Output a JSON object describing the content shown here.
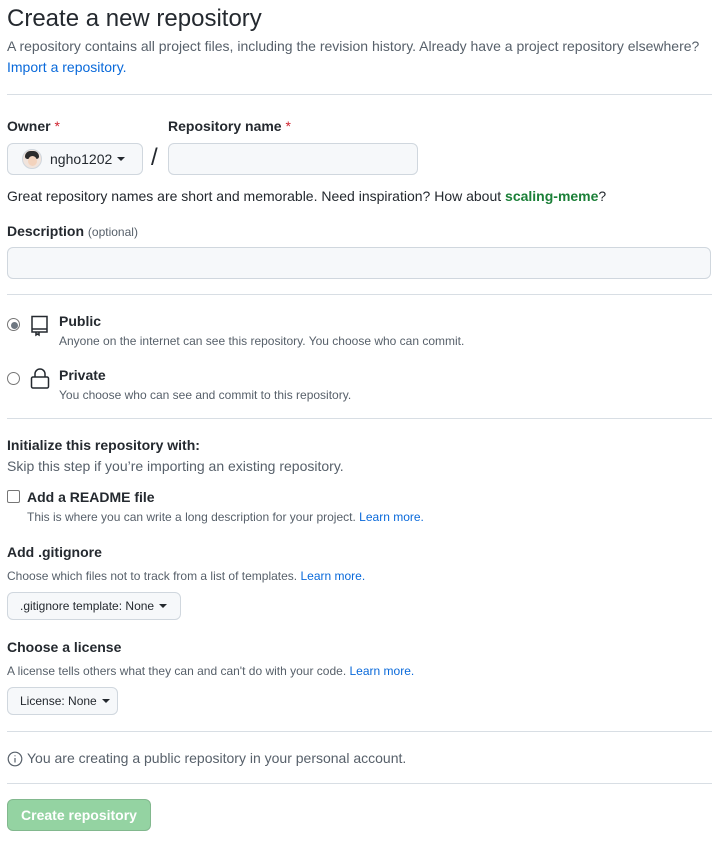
{
  "header": {
    "title": "Create a new repository",
    "subtitle": "A repository contains all project files, including the revision history. Already have a project repository elsewhere?",
    "import_link": "Import a repository."
  },
  "owner": {
    "label": "Owner",
    "required_mark": "*",
    "value": "ngho1202"
  },
  "repo_name": {
    "label": "Repository name",
    "required_mark": "*",
    "value": "",
    "slash": "/"
  },
  "suggestion": {
    "prefix": "Great repository names are short and memorable. Need inspiration? How about ",
    "name": "scaling-meme",
    "suffix": "?"
  },
  "description": {
    "label": "Description",
    "optional": "(optional)",
    "value": ""
  },
  "visibility": {
    "options": [
      {
        "label": "Public",
        "desc": "Anyone on the internet can see this repository. You choose who can commit.",
        "icon": "repo-icon",
        "selected": true
      },
      {
        "label": "Private",
        "desc": "You choose who can see and commit to this repository.",
        "icon": "lock-icon",
        "selected": false
      }
    ]
  },
  "init": {
    "heading": "Initialize this repository with:",
    "subtext": "Skip this step if you’re importing an existing repository.",
    "readme": {
      "label": "Add a README file",
      "desc": "This is where you can write a long description for your project.",
      "link": "Learn more.",
      "checked": false
    }
  },
  "gitignore": {
    "heading": "Add .gitignore",
    "desc": "Choose which files not to track from a list of templates.",
    "link": "Learn more.",
    "button_prefix": ".gitignore template:",
    "button_value": "None"
  },
  "license": {
    "heading": "Choose a license",
    "desc": "A license tells others what they can and can't do with your code.",
    "link": "Learn more.",
    "button_prefix": "License:",
    "button_value": "None"
  },
  "notice": {
    "text": "You are creating a public repository in your personal account."
  },
  "submit": {
    "label": "Create repository"
  },
  "colors": {
    "link": "#0969da",
    "required": "#cf222e",
    "suggestion": "#1a7f37",
    "submit_disabled": "#94d3a2"
  }
}
